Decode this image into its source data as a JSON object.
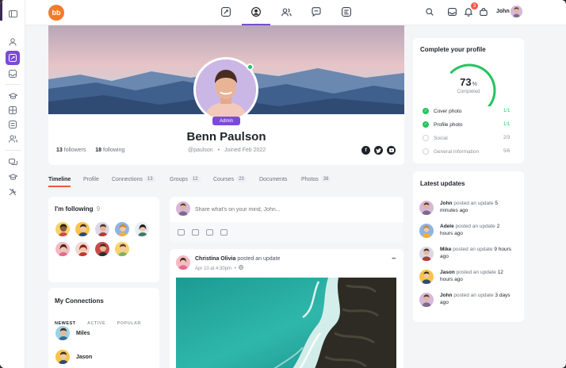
{
  "nav": {
    "user_name": "John",
    "notification_count": "3"
  },
  "profile": {
    "name": "Benn Paulson",
    "role_badge": "Admin",
    "followers_count": "13",
    "followers_label": "followers",
    "following_count": "18",
    "following_label": "following",
    "handle": "@paulson",
    "joined": "Joined Feb 2022"
  },
  "tabs": [
    {
      "label": "Timeline",
      "count": ""
    },
    {
      "label": "Profile",
      "count": ""
    },
    {
      "label": "Connections",
      "count": "13"
    },
    {
      "label": "Groups",
      "count": "12"
    },
    {
      "label": "Courses",
      "count": "23"
    },
    {
      "label": "Documents",
      "count": ""
    },
    {
      "label": "Photos",
      "count": "38"
    }
  ],
  "following": {
    "title": "I'm following",
    "count": "9"
  },
  "connections": {
    "title": "My Connections",
    "subtabs": [
      "NEWEST",
      "ACTIVE",
      "POPULAR"
    ],
    "people": [
      "Miles",
      "Jason"
    ]
  },
  "composer": {
    "placeholder": "Share what's on your mind, John..."
  },
  "post": {
    "author": "Christina Olivia",
    "action": "posted an update",
    "date": "Apr 10 at 4:30pm",
    "menu": "•••"
  },
  "complete_profile": {
    "title": "Complete your profile",
    "percent": "73",
    "percent_sign": "%",
    "status": "Completed",
    "progress": 0.73,
    "items": [
      {
        "label": "Cover photo",
        "count": "1/1",
        "done": true
      },
      {
        "label": "Profile photo",
        "count": "1/1",
        "done": true
      },
      {
        "label": "Social",
        "count": "2/3",
        "done": false
      },
      {
        "label": "General information",
        "count": "5/6",
        "done": false
      }
    ]
  },
  "latest_updates": {
    "title": "Latest updates",
    "items": [
      {
        "name": "John",
        "action": "posted an update",
        "time": "5 minutes ago"
      },
      {
        "name": "Adele",
        "action": "posted an update",
        "time": "2 hours ago"
      },
      {
        "name": "Mike",
        "action": "posted an update",
        "time": "9 hours ago"
      },
      {
        "name": "Jason",
        "action": "posted an update",
        "time": "12 hours ago"
      },
      {
        "name": "John",
        "action": "posted an update",
        "time": "3 days ago"
      }
    ]
  },
  "colors": {
    "accent": "#7c4bd6",
    "success": "#22c55e",
    "tab_underline": "#f0574b"
  }
}
